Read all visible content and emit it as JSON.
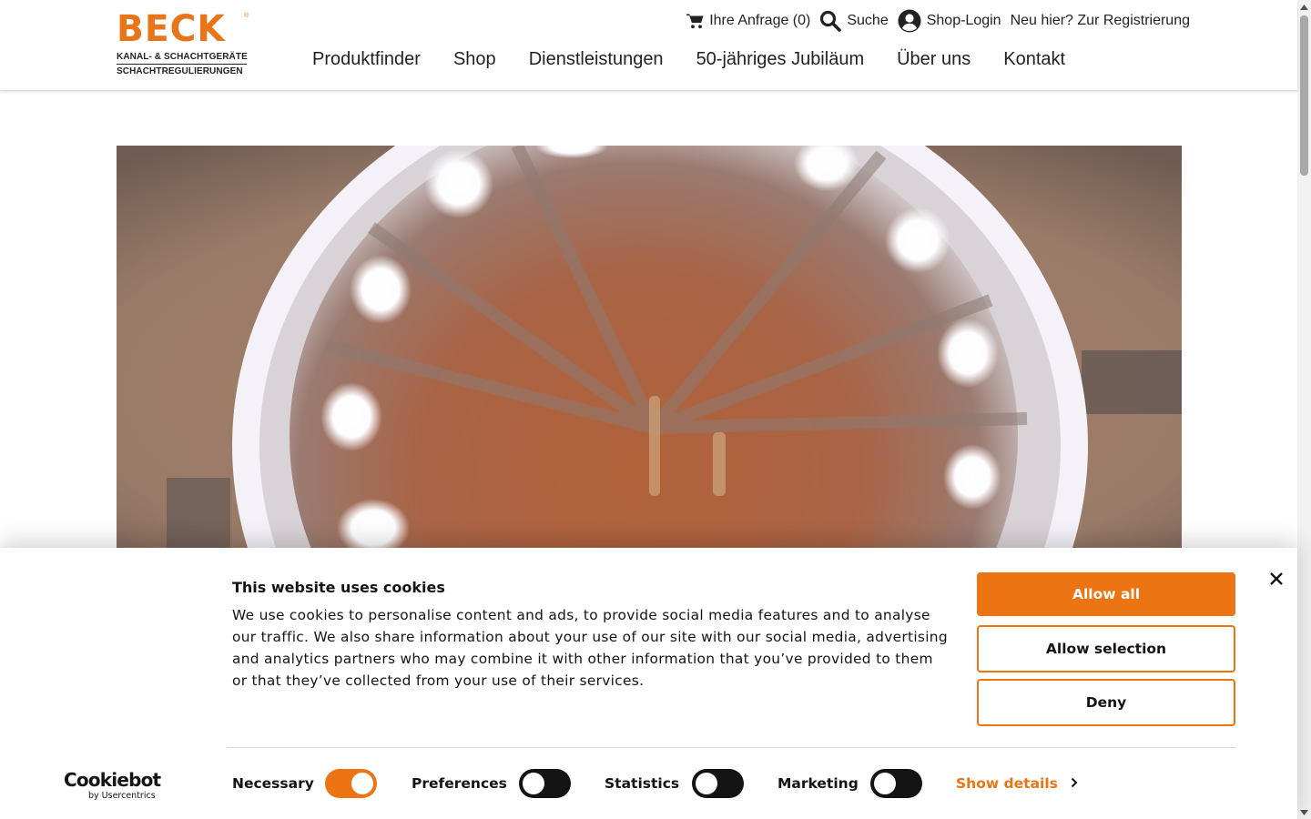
{
  "brand": {
    "logo_word": "BECK",
    "logo_registered": "®",
    "logo_line1": "KANAL- & SCHACHTGERÄTE",
    "logo_line2": "SCHACHTREGULIERUNGEN",
    "color": "#e8751a"
  },
  "utility_nav": {
    "request": {
      "icon": "cart-icon",
      "label": "Ihre Anfrage (0)"
    },
    "search": {
      "icon": "search-icon",
      "label": "Suche"
    },
    "login": {
      "icon": "user-circle-icon",
      "label": "Shop-Login"
    },
    "register": {
      "label": "Neu hier? Zur Registrierung"
    }
  },
  "main_nav": [
    {
      "label": "Produktfinder"
    },
    {
      "label": "Shop"
    },
    {
      "label": "Dienstleistungen"
    },
    {
      "label": "50-jähriges Jubiläum"
    },
    {
      "label": "Über uns"
    },
    {
      "label": "Kontakt"
    }
  ],
  "hero": {
    "image": "sewer-shaft-camera-view"
  },
  "cookie_banner": {
    "title": "This website uses cookies",
    "text": "We use cookies to personalise content and ads, to provide social media features and to analyse our traffic. We also share information about your use of our site with our social media, advertising and analytics partners who may combine it with other information that you’ve provided to them or that they’ve collected from your use of their services.",
    "buttons": {
      "allow_all": "Allow all",
      "allow_selection": "Allow selection",
      "deny": "Deny"
    },
    "toggles": [
      {
        "label": "Necessary",
        "on": true
      },
      {
        "label": "Preferences",
        "on": false
      },
      {
        "label": "Statistics",
        "on": false
      },
      {
        "label": "Marketing",
        "on": false
      }
    ],
    "show_details": "Show details",
    "provider_logo": "Cookiebot",
    "provider_sub": "by Usercentrics",
    "accent_color": "#ec7413"
  }
}
